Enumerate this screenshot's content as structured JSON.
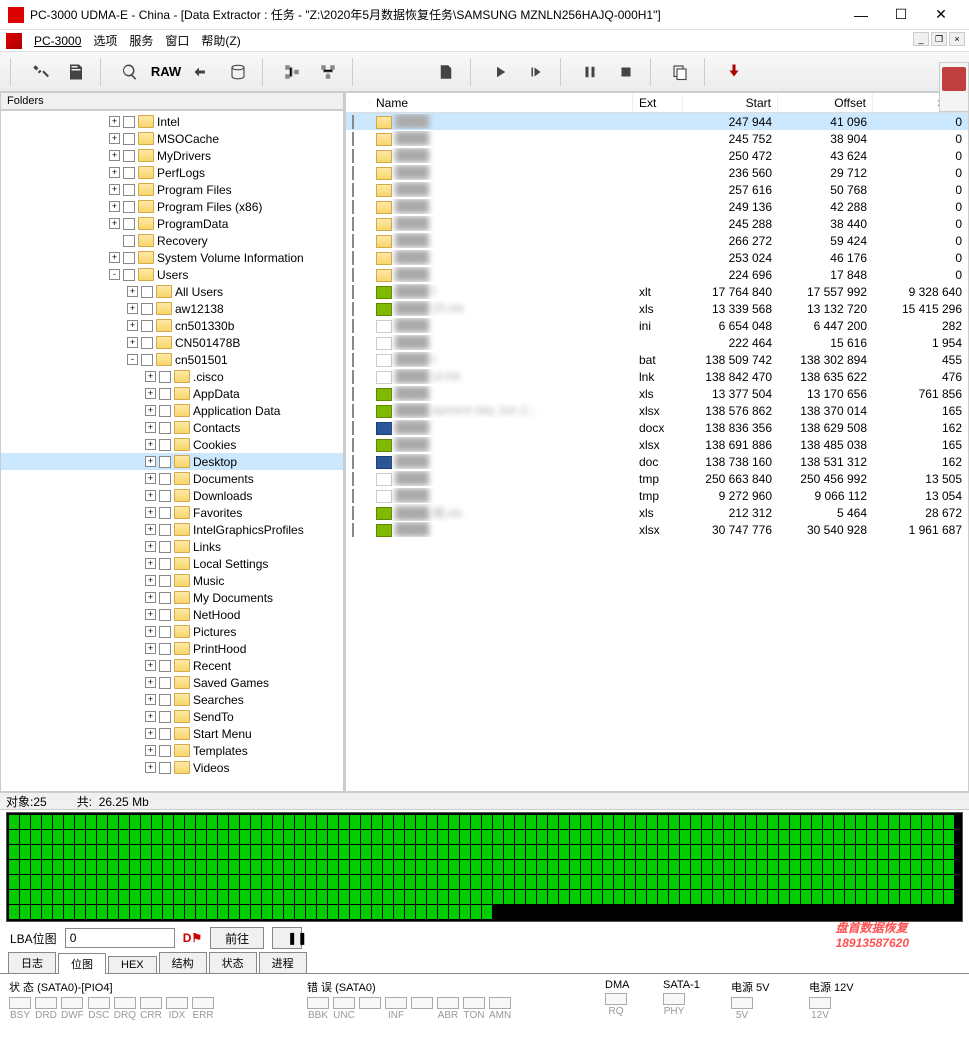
{
  "title": "PC-3000 UDMA-E - China - [Data Extractor : 任务 - \"Z:\\2020年5月数据恢复任务\\SAMSUNG MZNLN256HAJQ-000H1\"]",
  "menu": {
    "pc3000": "PC-3000",
    "options": "选项",
    "service": "服务",
    "window": "窗口",
    "help": "帮助(Z)"
  },
  "toolbar": {
    "raw": "RAW"
  },
  "folders_label": "Folders",
  "tree": [
    {
      "d": 1,
      "exp": "+",
      "label": "Intel"
    },
    {
      "d": 1,
      "exp": "+",
      "label": "MSOCache"
    },
    {
      "d": 1,
      "exp": "+",
      "label": "MyDrivers"
    },
    {
      "d": 1,
      "exp": "+",
      "label": "PerfLogs"
    },
    {
      "d": 1,
      "exp": "+",
      "label": "Program Files"
    },
    {
      "d": 1,
      "exp": "+",
      "label": "Program Files (x86)"
    },
    {
      "d": 1,
      "exp": "+",
      "label": "ProgramData"
    },
    {
      "d": 1,
      "exp": " ",
      "label": "Recovery"
    },
    {
      "d": 1,
      "exp": "+",
      "label": "System Volume Information"
    },
    {
      "d": 1,
      "exp": "-",
      "label": "Users"
    },
    {
      "d": 2,
      "exp": "+",
      "label": "All Users"
    },
    {
      "d": 2,
      "exp": "+",
      "label": "aw12138"
    },
    {
      "d": 2,
      "exp": "+",
      "label": "cn501330b"
    },
    {
      "d": 2,
      "exp": "+",
      "label": "CN501478B"
    },
    {
      "d": 2,
      "exp": "-",
      "label": "cn501501"
    },
    {
      "d": 3,
      "exp": "+",
      "label": ".cisco"
    },
    {
      "d": 3,
      "exp": "+",
      "label": "AppData"
    },
    {
      "d": 3,
      "exp": "+",
      "label": "Application Data"
    },
    {
      "d": 3,
      "exp": "+",
      "label": "Contacts"
    },
    {
      "d": 3,
      "exp": "+",
      "label": "Cookies"
    },
    {
      "d": 3,
      "exp": "+",
      "label": "Desktop",
      "selected": true
    },
    {
      "d": 3,
      "exp": "+",
      "label": "Documents"
    },
    {
      "d": 3,
      "exp": "+",
      "label": "Downloads"
    },
    {
      "d": 3,
      "exp": "+",
      "label": "Favorites"
    },
    {
      "d": 3,
      "exp": "+",
      "label": "IntelGraphicsProfiles"
    },
    {
      "d": 3,
      "exp": "+",
      "label": "Links"
    },
    {
      "d": 3,
      "exp": "+",
      "label": "Local Settings"
    },
    {
      "d": 3,
      "exp": "+",
      "label": "Music"
    },
    {
      "d": 3,
      "exp": "+",
      "label": "My Documents"
    },
    {
      "d": 3,
      "exp": "+",
      "label": "NetHood"
    },
    {
      "d": 3,
      "exp": "+",
      "label": "Pictures"
    },
    {
      "d": 3,
      "exp": "+",
      "label": "PrintHood"
    },
    {
      "d": 3,
      "exp": "+",
      "label": "Recent"
    },
    {
      "d": 3,
      "exp": "+",
      "label": "Saved Games"
    },
    {
      "d": 3,
      "exp": "+",
      "label": "Searches"
    },
    {
      "d": 3,
      "exp": "+",
      "label": "SendTo"
    },
    {
      "d": 3,
      "exp": "+",
      "label": "Start Menu"
    },
    {
      "d": 3,
      "exp": "+",
      "label": "Templates"
    },
    {
      "d": 3,
      "exp": "+",
      "label": "Videos"
    }
  ],
  "file_columns": {
    "name": "Name",
    "ext": "Ext",
    "start": "Start",
    "offset": "Offset",
    "size": "Size"
  },
  "files": [
    {
      "icon": "folder",
      "name": "",
      "ext": "",
      "start": "247 944",
      "offset": "41 096",
      "size": "0",
      "selected": true
    },
    {
      "icon": "folder",
      "name": "",
      "ext": "",
      "start": "245 752",
      "offset": "38 904",
      "size": "0"
    },
    {
      "icon": "folder",
      "name": "",
      "ext": "",
      "start": "250 472",
      "offset": "43 624",
      "size": "0"
    },
    {
      "icon": "folder",
      "name": "",
      "ext": "",
      "start": "236 560",
      "offset": "29 712",
      "size": "0"
    },
    {
      "icon": "folder",
      "name": "",
      "ext": "",
      "start": "257 616",
      "offset": "50 768",
      "size": "0"
    },
    {
      "icon": "folder",
      "name": "",
      "ext": "",
      "start": "249 136",
      "offset": "42 288",
      "size": "0"
    },
    {
      "icon": "folder",
      "name": "",
      "ext": "",
      "start": "245 288",
      "offset": "38 440",
      "size": "0"
    },
    {
      "icon": "folder",
      "name": "",
      "ext": "",
      "start": "266 272",
      "offset": "59 424",
      "size": "0"
    },
    {
      "icon": "folder",
      "name": "",
      "ext": "",
      "start": "253 024",
      "offset": "46 176",
      "size": "0"
    },
    {
      "icon": "folder",
      "name": "",
      "ext": "",
      "start": "224 696",
      "offset": "17 848",
      "size": "0"
    },
    {
      "icon": "xls",
      "name": "t",
      "ext": "xlt",
      "start": "17 764 840",
      "offset": "17 557 992",
      "size": "9 328 640"
    },
    {
      "icon": "xls",
      "name": "20.xls",
      "ext": "xls",
      "start": "13 339 568",
      "offset": "13 132 720",
      "size": "15 415 296"
    },
    {
      "icon": "file",
      "name": "",
      "ext": "ini",
      "start": "6 654 048",
      "offset": "6 447 200",
      "size": "282"
    },
    {
      "icon": "file",
      "name": "",
      "ext": "",
      "start": "222 464",
      "offset": "15 616",
      "size": "1 954"
    },
    {
      "icon": "file",
      "name": "t",
      "ext": "bat",
      "start": "138 509 742",
      "offset": "138 302 894",
      "size": "455"
    },
    {
      "icon": "file",
      "name": "ut.lnk",
      "ext": "lnk",
      "start": "138 842 470",
      "offset": "138 635 622",
      "size": "476"
    },
    {
      "icon": "xls",
      "name": "",
      "ext": "xls",
      "start": "13 377 504",
      "offset": "13 170 656",
      "size": "761 856"
    },
    {
      "icon": "xls",
      "name": "ayment day Jun 2...",
      "ext": "xlsx",
      "start": "138 576 862",
      "offset": "138 370 014",
      "size": "165"
    },
    {
      "icon": "doc",
      "name": "",
      "ext": "docx",
      "start": "138 836 356",
      "offset": "138 629 508",
      "size": "162"
    },
    {
      "icon": "xls",
      "name": "",
      "ext": "xlsx",
      "start": "138 691 886",
      "offset": "138 485 038",
      "size": "165"
    },
    {
      "icon": "doc",
      "name": "",
      "ext": "doc",
      "start": "138 738 160",
      "offset": "138 531 312",
      "size": "162"
    },
    {
      "icon": "file",
      "name": "",
      "ext": "tmp",
      "start": "250 663 840",
      "offset": "250 456 992",
      "size": "13 505"
    },
    {
      "icon": "file",
      "name": "",
      "ext": "tmp",
      "start": "9 272 960",
      "offset": "9 066 112",
      "size": "13 054"
    },
    {
      "icon": "xls",
      "name": "细.xls",
      "ext": "xls",
      "start": "212 312",
      "offset": "5 464",
      "size": "28 672"
    },
    {
      "icon": "xls",
      "name": "",
      "ext": "xlsx",
      "start": "30 747 776",
      "offset": "30 540 928",
      "size": "1 961 687"
    }
  ],
  "status": {
    "objects_label": "对象:25",
    "total_label": "共:",
    "total_value": "26.25 Mb"
  },
  "lba": {
    "label": "LBA位图",
    "value": "0",
    "goto": "前往"
  },
  "tabs": [
    "日志",
    "位图",
    "HEX",
    "结构",
    "状态",
    "进程"
  ],
  "active_tab": 1,
  "watermark_text": "盘首数据恢复",
  "watermark_phone": "18913587620",
  "bottom": {
    "state_label": "状 态 (SATA0)-[PIO4]",
    "state_bits": [
      "BSY",
      "DRD",
      "DWF",
      "DSC",
      "DRQ",
      "CRR",
      "IDX",
      "ERR"
    ],
    "error_label": "错 误 (SATA0)",
    "error_bits": [
      "BBK",
      "UNC",
      "",
      "INF",
      "",
      "ABR",
      "TON",
      "AMN"
    ],
    "dma_label": "DMA",
    "dma_bits": [
      "RQ"
    ],
    "sata1_label": "SATA-1",
    "sata1_bits": [
      "PHY"
    ],
    "pwr5_label": "电源 5V",
    "pwr5_bits": [
      "5V"
    ],
    "pwr12_label": "电源 12V",
    "pwr12_bits": [
      "12V"
    ]
  }
}
